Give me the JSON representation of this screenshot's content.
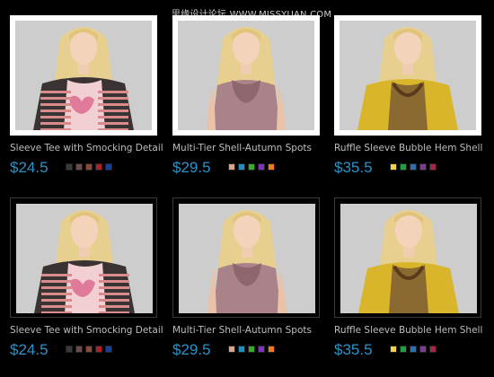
{
  "watermark": "思缘设计论坛 WWW.MISSYUAN.COM",
  "products": [
    {
      "title": "Sleeve Tee with Smocking Detail",
      "price": "$24.5",
      "swatches": [
        "#3a3a3a",
        "#6b4b4b",
        "#8a4a3a",
        "#b0202a",
        "#1a3f9a"
      ],
      "selected": true,
      "style": "cardigan"
    },
    {
      "title": "Multi-Tier Shell-Autumn Spots",
      "price": "$29.5",
      "swatches": [
        "#d9a391",
        "#1f8fbf",
        "#3bab2b",
        "#7a38b8",
        "#f07a1c"
      ],
      "selected": true,
      "style": "blouse"
    },
    {
      "title": "Ruffle Sleeve Bubble Hem Shell",
      "price": "$35.5",
      "swatches": [
        "#f2d24a",
        "#20a040",
        "#2f6fb0",
        "#7a3f90",
        "#a0294a"
      ],
      "selected": true,
      "style": "yellow"
    },
    {
      "title": "Sleeve Tee with Smocking Detail",
      "price": "$24.5",
      "swatches": [
        "#3a3a3a",
        "#6b4b4b",
        "#8a4a3a",
        "#b0202a",
        "#1a3f9a"
      ],
      "selected": false,
      "style": "cardigan"
    },
    {
      "title": "Multi-Tier Shell-Autumn Spots",
      "price": "$29.5",
      "swatches": [
        "#d9a391",
        "#1f8fbf",
        "#3bab2b",
        "#7a38b8",
        "#f07a1c"
      ],
      "selected": false,
      "style": "blouse"
    },
    {
      "title": "Ruffle Sleeve Bubble Hem Shell",
      "price": "$35.5",
      "swatches": [
        "#f2d24a",
        "#20a040",
        "#2f6fb0",
        "#7a3f90",
        "#a0294a"
      ],
      "selected": false,
      "style": "yellow"
    }
  ]
}
